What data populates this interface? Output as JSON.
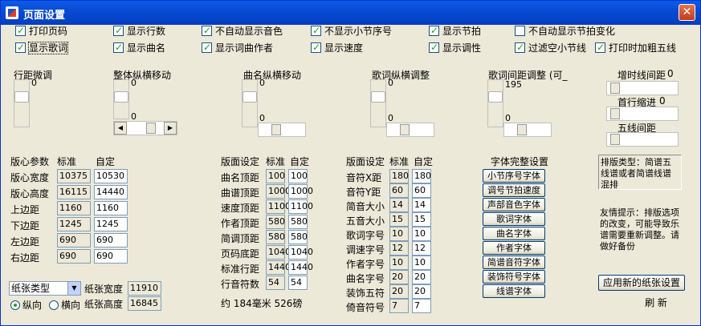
{
  "window": {
    "title": "页面设置",
    "close": "✕"
  },
  "checkboxes": [
    {
      "label": "打印页码",
      "checked": true
    },
    {
      "label": "显示行数",
      "checked": true
    },
    {
      "label": "不自动显示音色",
      "checked": true
    },
    {
      "label": "不显示小节序号",
      "checked": true
    },
    {
      "label": "显示节拍",
      "checked": true
    },
    {
      "label": "不自动显示节拍变化",
      "checked": false
    },
    {
      "label": "显示歌词",
      "checked": true
    },
    {
      "label": "显示曲名",
      "checked": true
    },
    {
      "label": "显示词曲作者",
      "checked": true
    },
    {
      "label": "显示速度",
      "checked": true
    },
    {
      "label": "显示调性",
      "checked": true
    },
    {
      "label": "过滤空小节线",
      "checked": true
    },
    {
      "label": "打印时加粗五线",
      "checked": true
    }
  ],
  "sliders": {
    "hangjuweitiao": {
      "label": "行距微调",
      "value": "0"
    },
    "zhengti": {
      "label": "整体纵横移动",
      "v": "0",
      "h": "0"
    },
    "quming": {
      "label": "曲名纵横移动",
      "v": "0",
      "h": "0"
    },
    "geci": {
      "label": "歌词纵横调整",
      "v": "0",
      "h": "0"
    },
    "gecijianju": {
      "label": "歌词间距调整 (可_",
      "v": "195",
      "h": "0"
    },
    "zengshi": {
      "label": "增时线间距",
      "value": "0"
    },
    "shouhang": {
      "label": "首行缩进",
      "value": "0"
    },
    "wuxian": {
      "label": "五线间距"
    }
  },
  "banxin": {
    "header": {
      "title": "版心参数",
      "std": "标准",
      "custom": "自定"
    },
    "rows": [
      {
        "label": "版心宽度",
        "std": "10375",
        "custom": "10530"
      },
      {
        "label": "版心高度",
        "std": "16115",
        "custom": "14440"
      },
      {
        "label": "上边距",
        "std": "1160",
        "custom": "1160"
      },
      {
        "label": "下边距",
        "std": "1245",
        "custom": "1245"
      },
      {
        "label": "左边距",
        "std": "690",
        "custom": "690"
      },
      {
        "label": "右边距",
        "std": "690",
        "custom": "690"
      }
    ]
  },
  "banmian1": {
    "header": {
      "title": "版面设定",
      "std": "标准",
      "custom": "自定"
    },
    "rows": [
      {
        "label": "曲名顶距",
        "std": "100",
        "custom": "100"
      },
      {
        "label": "曲谱顶距",
        "std": "1000",
        "custom": "1000"
      },
      {
        "label": "速度顶距",
        "std": "1100",
        "custom": "1100"
      },
      {
        "label": "作者顶距",
        "std": "580",
        "custom": "580"
      },
      {
        "label": "简调顶距",
        "std": "580",
        "custom": "580"
      },
      {
        "label": "页码底距",
        "std": "1040",
        "custom": "1040"
      },
      {
        "label": "标准行距",
        "std": "1440",
        "custom": "1440"
      },
      {
        "label": "行音符数",
        "std": "54",
        "custom": "54"
      }
    ]
  },
  "banmian2": {
    "header": {
      "title": "版面设定",
      "std": "标准",
      "custom": "自定"
    },
    "rows": [
      {
        "label": "音符X距",
        "std": "180",
        "custom": "180"
      },
      {
        "label": "音符Y距",
        "std": "60",
        "custom": "60"
      },
      {
        "label": "简音大小",
        "std": "14",
        "custom": "14"
      },
      {
        "label": "五音大小",
        "std": "15",
        "custom": "15"
      },
      {
        "label": "歌词字号",
        "std": "10",
        "custom": "10"
      },
      {
        "label": "调速字号",
        "std": "12",
        "custom": "12"
      },
      {
        "label": "作者字号",
        "std": "10",
        "custom": "10"
      },
      {
        "label": "曲名字号",
        "std": "20",
        "custom": "20"
      },
      {
        "label": "装饰五符",
        "std": "20",
        "custom": "20"
      },
      {
        "label": "倚音符号",
        "std": "7",
        "custom": "7"
      }
    ]
  },
  "fonts": {
    "title": "字体完整设置",
    "buttons": [
      "小节序号字体",
      "调号节拍速度",
      "声部音色字体",
      "歌词字体",
      "曲名字体",
      "作者字体",
      "简谱音符字体",
      "装饰符号字体",
      "线谱字体"
    ]
  },
  "info": {
    "type_text": "排版类型：简谱五线谱或者简谱线谱混排",
    "tip_text": "友情提示：排版选项的改变，可能导致乐谱需要重新调整。请做好备份"
  },
  "paper": {
    "select": "纸张类型",
    "width_label": "纸张宽度",
    "width": "11910",
    "height_label": "纸张高度",
    "height": "16845",
    "portrait": "纵向",
    "landscape": "横向",
    "size_text": "约 184毫米 526磅"
  },
  "actions": {
    "apply": "应用新的纸张设置",
    "refresh": "刷 新"
  },
  "colors": {
    "title_bar": "#0a4bd4",
    "window_bg": "#ece9d8",
    "check": "#21a121"
  }
}
